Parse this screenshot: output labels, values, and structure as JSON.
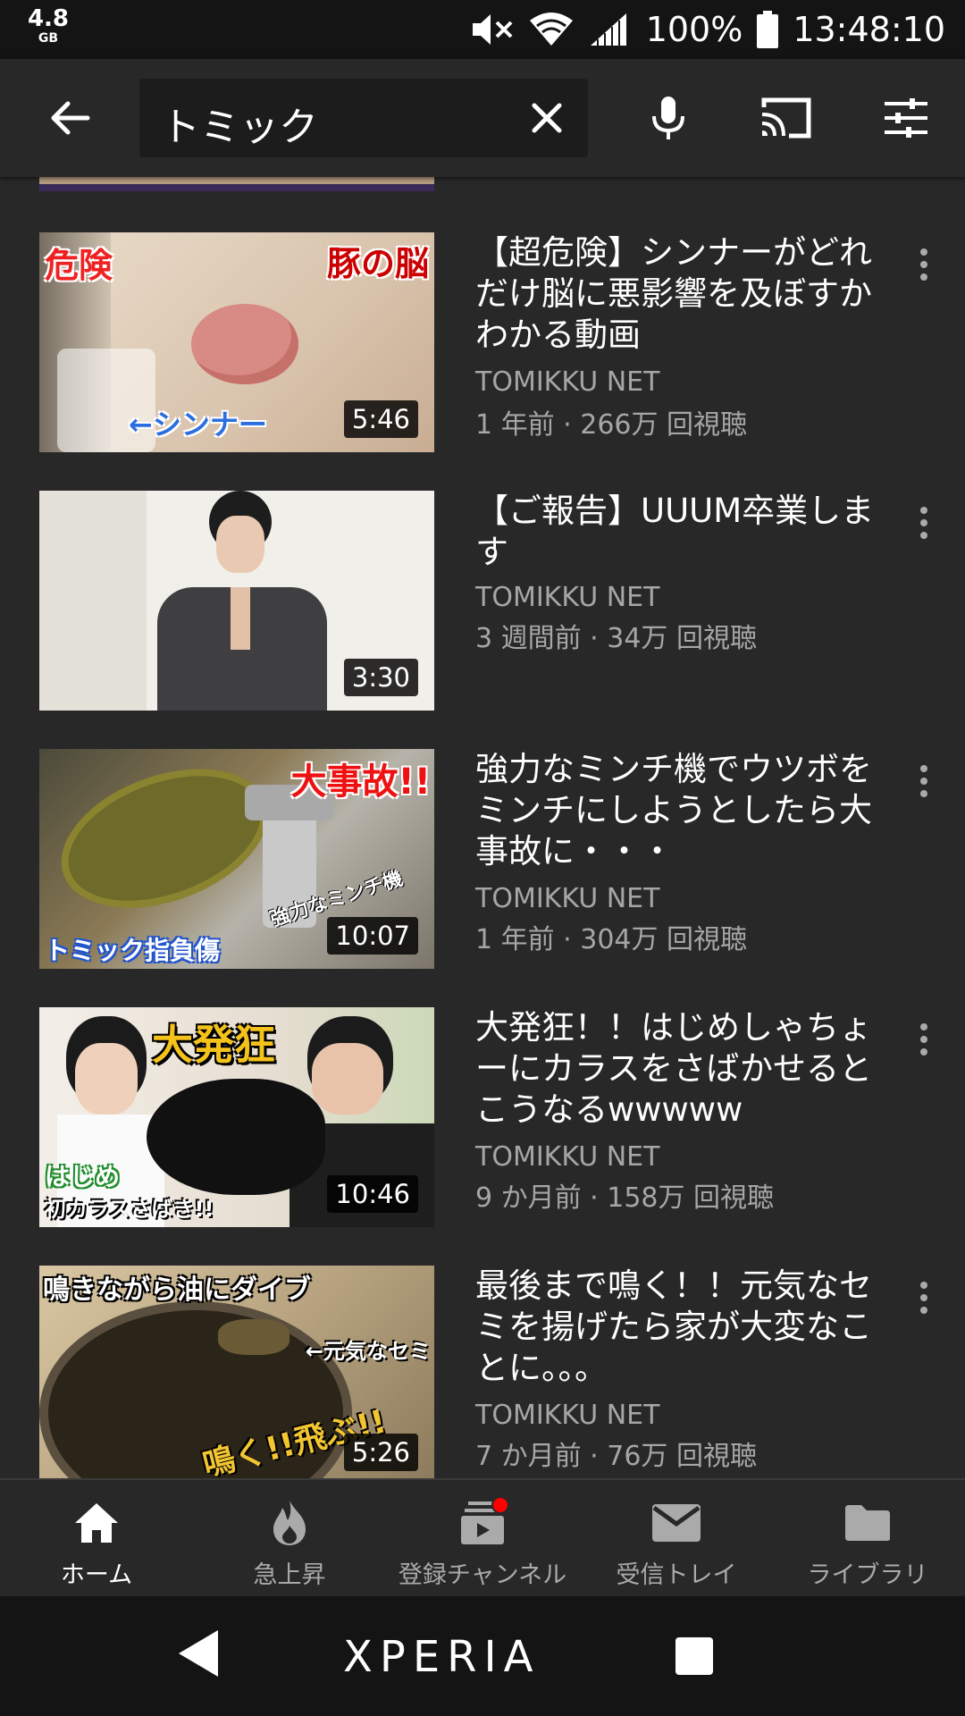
{
  "status_bar": {
    "memory_value": "4.8",
    "memory_unit": "GB",
    "battery": "100%",
    "time": "13:48:10",
    "icons": [
      "mute-icon",
      "wifi-icon",
      "signal-icon",
      "battery-icon"
    ]
  },
  "search": {
    "query": "トミック",
    "icons": [
      "back-arrow-icon",
      "clear-icon",
      "mic-icon",
      "cast-icon",
      "filter-icon"
    ]
  },
  "videos": [
    {
      "title": "【超危険】シンナーがどれだけ脳に悪影響を及ぼすかわかる動画",
      "channel": "TOMIKKU NET",
      "meta": "1 年前 · 266万 回視聴",
      "duration": "5:46",
      "thumb_text": [
        "危険",
        "豚の脳",
        "←シンナー"
      ]
    },
    {
      "title": "【ご報告】UUUM卒業します",
      "channel": "TOMIKKU NET",
      "meta": "3 週間前 · 34万 回視聴",
      "duration": "3:30",
      "thumb_text": []
    },
    {
      "title": "強力なミンチ機でウツボをミンチにしようとしたら大事故に・・・",
      "channel": "TOMIKKU NET",
      "meta": "1 年前 · 304万 回視聴",
      "duration": "10:07",
      "thumb_text": [
        "大事故!!",
        "トミック指負傷",
        "強力なミンチ機"
      ]
    },
    {
      "title": "大発狂！！はじめしゃちょーにカラスをさばかせるとこうなるwwwww",
      "channel": "TOMIKKU NET",
      "meta": "9 か月前 · 158万 回視聴",
      "duration": "10:46",
      "thumb_text": [
        "大発狂",
        "はじめ",
        "初カラスさばき!!"
      ]
    },
    {
      "title": "最後まで鳴く！！元気なセミを揚げたら家が大変なことに。。。",
      "channel": "TOMIKKU NET",
      "meta": "7 か月前 · 76万 回視聴",
      "duration": "5:26",
      "thumb_text": [
        "鳴きながら油にダイブ",
        "←元気なセミ",
        "鳴く!!飛ぶ!!"
      ]
    }
  ],
  "bottom_nav": [
    {
      "label": "ホーム",
      "icon": "home-icon",
      "active": true
    },
    {
      "label": "急上昇",
      "icon": "trending-flame-icon",
      "active": false
    },
    {
      "label": "登録チャンネル",
      "icon": "subscriptions-icon",
      "active": false,
      "badge": true
    },
    {
      "label": "受信トレイ",
      "icon": "inbox-mail-icon",
      "active": false
    },
    {
      "label": "ライブラリ",
      "icon": "library-folder-icon",
      "active": false
    }
  ],
  "system_nav": {
    "brand": "XPERIA",
    "icons": [
      "nav-back-icon",
      "nav-recent-icon"
    ]
  },
  "colors": {
    "background": "#282828",
    "status_bar": "#141414",
    "secondary_text": "#a6a6a6",
    "badge_red": "#ff0000"
  }
}
